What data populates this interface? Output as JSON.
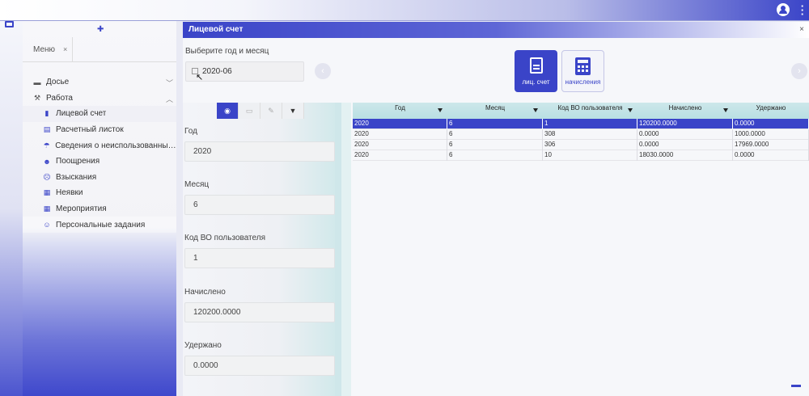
{
  "sidebar": {
    "tab_label": "Меню",
    "tab_close": "×",
    "items": [
      {
        "label": "Досье",
        "icon": "archive-icon",
        "level": 0,
        "chevron": "﹀"
      },
      {
        "label": "Работа",
        "icon": "hammer-icon",
        "level": 0,
        "chevron": "︿"
      },
      {
        "label": "Лицевой счет",
        "icon": "document-icon",
        "level": 1
      },
      {
        "label": "Расчетный листок",
        "icon": "list-icon",
        "level": 1
      },
      {
        "label": "Сведения о неиспользованных д...",
        "icon": "beach-umbrella-icon",
        "level": 1
      },
      {
        "label": "Поощрения",
        "icon": "smile-icon",
        "level": 1
      },
      {
        "label": "Взыскания",
        "icon": "frown-icon",
        "level": 1
      },
      {
        "label": "Неявки",
        "icon": "calendar-icon",
        "level": 1
      },
      {
        "label": "Мероприятия",
        "icon": "calendar-check-icon",
        "level": 1
      },
      {
        "label": "Персональные задания",
        "icon": "user-gear-icon",
        "level": 1
      }
    ]
  },
  "main": {
    "title": "Лицевой счет",
    "close": "×",
    "select_label": "Выберите год и месяц",
    "period_value": "2020-06",
    "buttons": {
      "account_label": "лиц. счет",
      "accruals_label": "начисления"
    }
  },
  "form": {
    "fields": [
      {
        "label": "Год",
        "value": "2020"
      },
      {
        "label": "Месяц",
        "value": "6"
      },
      {
        "label": "Код ВО пользователя",
        "value": "1"
      },
      {
        "label": "Начислено",
        "value": "120200.0000"
      },
      {
        "label": "Удержано",
        "value": "0.0000"
      }
    ]
  },
  "grid": {
    "columns": [
      "Год",
      "Месяц",
      "Код ВО пользователя",
      "Начислено",
      "Удержано"
    ],
    "rows": [
      [
        "2020",
        "6",
        "1",
        "120200.0000",
        "0.0000"
      ],
      [
        "2020",
        "6",
        "308",
        "0.0000",
        "1000.0000"
      ],
      [
        "2020",
        "6",
        "306",
        "0.0000",
        "17969.0000"
      ],
      [
        "2020",
        "6",
        "10",
        "18030.0000",
        "0.0000"
      ]
    ],
    "selected_row": 0
  },
  "colors": {
    "accent": "#3a44c8",
    "grid_header": "#c4e3e6"
  }
}
